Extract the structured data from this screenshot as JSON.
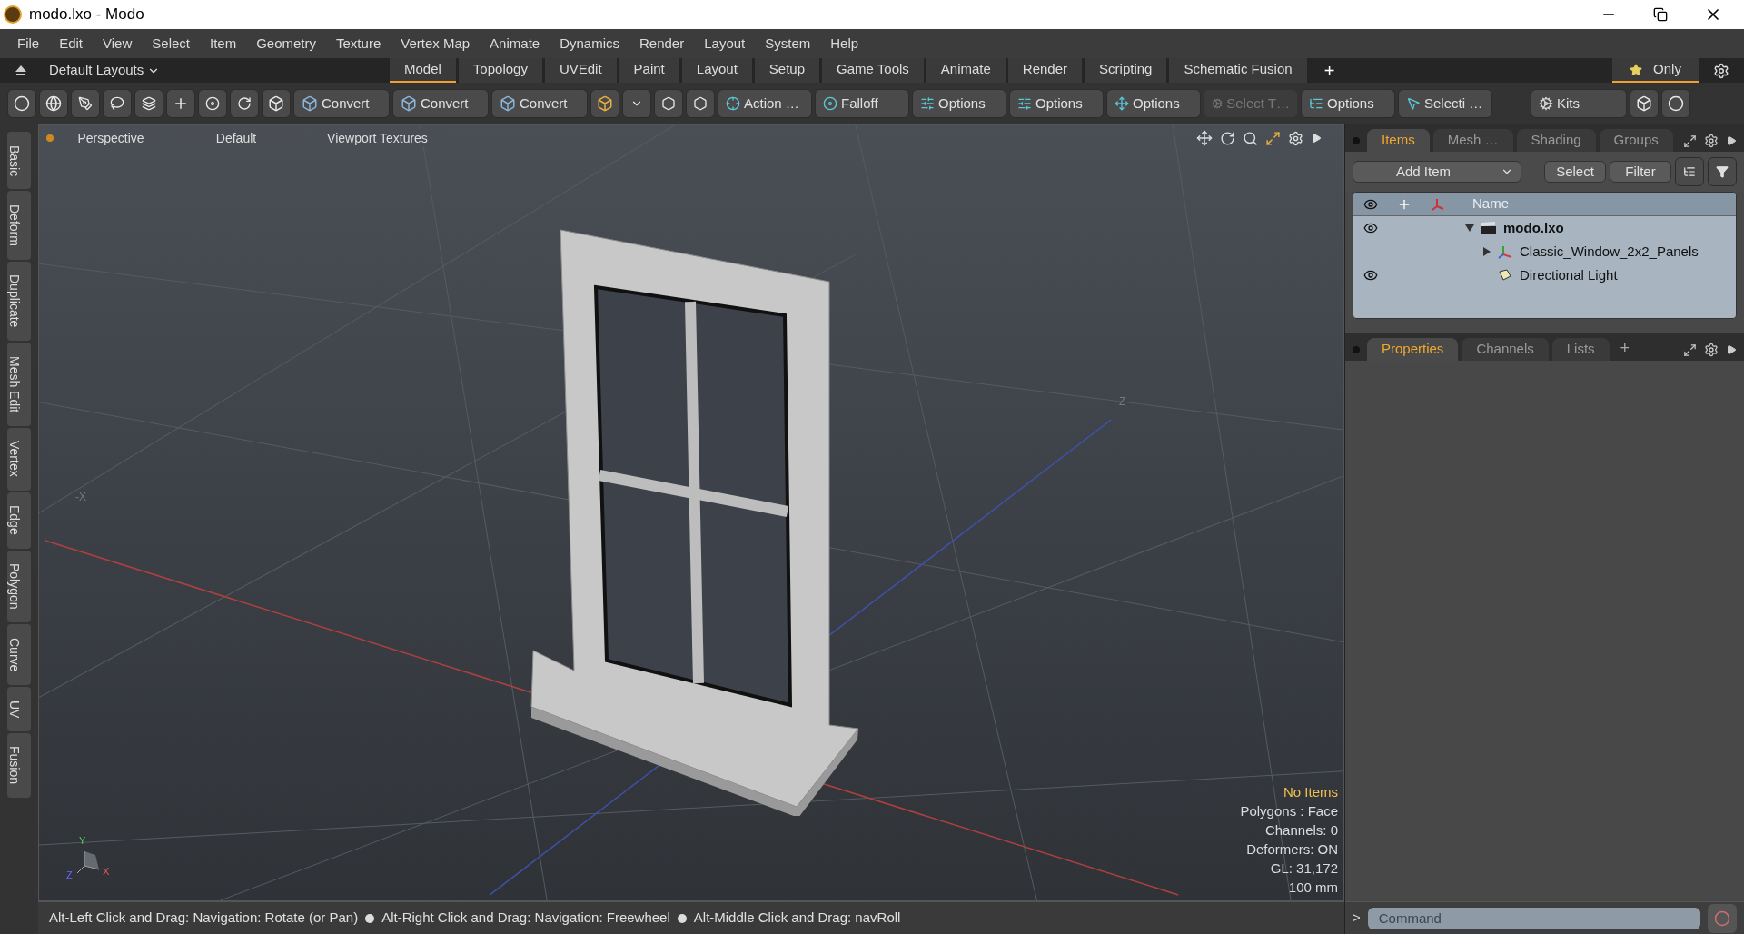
{
  "window": {
    "title": "modo.lxo - Modo"
  },
  "menu": [
    "File",
    "Edit",
    "View",
    "Select",
    "Item",
    "Geometry",
    "Texture",
    "Vertex Map",
    "Animate",
    "Dynamics",
    "Render",
    "Layout",
    "System",
    "Help"
  ],
  "layout_bar": {
    "layouts": "Default Layouts",
    "tabs": [
      {
        "label": "Model",
        "selected": true
      },
      {
        "label": "Topology",
        "selected": false
      },
      {
        "label": "UVEdit",
        "selected": false
      },
      {
        "label": "Paint",
        "selected": false
      },
      {
        "label": "Layout",
        "selected": false
      },
      {
        "label": "Setup",
        "selected": false
      },
      {
        "label": "Game Tools",
        "selected": false
      },
      {
        "label": "Animate",
        "selected": false
      },
      {
        "label": "Render",
        "selected": false
      },
      {
        "label": "Scripting",
        "selected": false
      },
      {
        "label": "Schematic Fusion",
        "selected": false
      }
    ],
    "add": "+",
    "only": "Only"
  },
  "toolbar": {
    "converts": [
      "Convert",
      "Convert",
      "Convert"
    ],
    "buttons": [
      {
        "label": "Action …",
        "disabled": false
      },
      {
        "label": "Falloff",
        "disabled": false
      },
      {
        "label": "Options",
        "disabled": false
      },
      {
        "label": "Options",
        "disabled": false
      },
      {
        "label": "Options",
        "disabled": false
      },
      {
        "label": "Select T…",
        "disabled": true
      },
      {
        "label": "Options",
        "disabled": false
      },
      {
        "label": "Selecti …",
        "disabled": false
      }
    ],
    "kits": "Kits"
  },
  "left_tabs": [
    "Basic",
    "Deform",
    "Duplicate",
    "Mesh Edit",
    "Vertex",
    "Edge",
    "Polygon",
    "Curve",
    "UV",
    "Fusion"
  ],
  "viewport": {
    "view": "Perspective",
    "shading": "Default",
    "textures": "Viewport Textures",
    "axis_labels": [
      "-X",
      "-Z"
    ],
    "gizmo": [
      "Y",
      "Z",
      "X"
    ],
    "info": [
      {
        "text": "No Items",
        "kind": "highlight"
      },
      {
        "text": "Polygons : Face",
        "kind": "normal"
      },
      {
        "text": "Channels: 0",
        "kind": "normal"
      },
      {
        "text": "Deformers: ON",
        "kind": "normal"
      },
      {
        "text": "GL: 31,172",
        "kind": "normal"
      },
      {
        "text": "100 mm",
        "kind": "normal"
      }
    ]
  },
  "status_bar": [
    "Alt-Left Click and Drag: Navigation: Rotate (or Pan)",
    "Alt-Right Click and Drag: Navigation: Freewheel",
    "Alt-Middle Click and Drag: navRoll"
  ],
  "items_panel": {
    "tabs": [
      {
        "label": "Items",
        "selected": true
      },
      {
        "label": "Mesh …",
        "selected": false
      },
      {
        "label": "Shading",
        "selected": false
      },
      {
        "label": "Groups",
        "selected": false
      }
    ],
    "add_item": "Add Item",
    "buttons": [
      "Select",
      "Filter"
    ],
    "column": "Name",
    "tree": [
      {
        "name": "modo.lxo",
        "kind": "scene",
        "visible": true,
        "expanded": true,
        "children": [
          {
            "name": "Classic_Window_2x2_Panels",
            "kind": "mesh",
            "visible": false,
            "expanded": false
          },
          {
            "name": "Directional Light",
            "kind": "light",
            "visible": true
          }
        ]
      }
    ]
  },
  "properties_panel": {
    "tabs": [
      {
        "label": "Properties",
        "selected": true
      },
      {
        "label": "Channels",
        "selected": false
      },
      {
        "label": "Lists",
        "selected": false
      }
    ],
    "add": "+"
  },
  "command": {
    "prompt": ">",
    "placeholder": "Command"
  }
}
